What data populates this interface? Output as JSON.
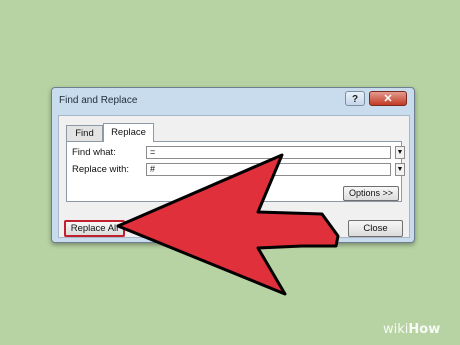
{
  "dialog": {
    "title": "Find and Replace",
    "help_label": "?",
    "close_x_label": "✕",
    "tabs": [
      {
        "label": "Find",
        "active": false
      },
      {
        "label": "Replace",
        "active": true
      }
    ],
    "find_label": "Find what:",
    "find_value": "=",
    "replace_label": "Replace with:",
    "replace_value": "#",
    "dropdown_glyph": "▼",
    "options_label": "Options >>",
    "replace_all_label": "Replace All",
    "close_label": "Close"
  },
  "annotation": {
    "arrow_color": "#e0303c",
    "arrow_target": "replace-all-button"
  },
  "watermark": {
    "prefix": "wiki",
    "suffix": "How"
  }
}
